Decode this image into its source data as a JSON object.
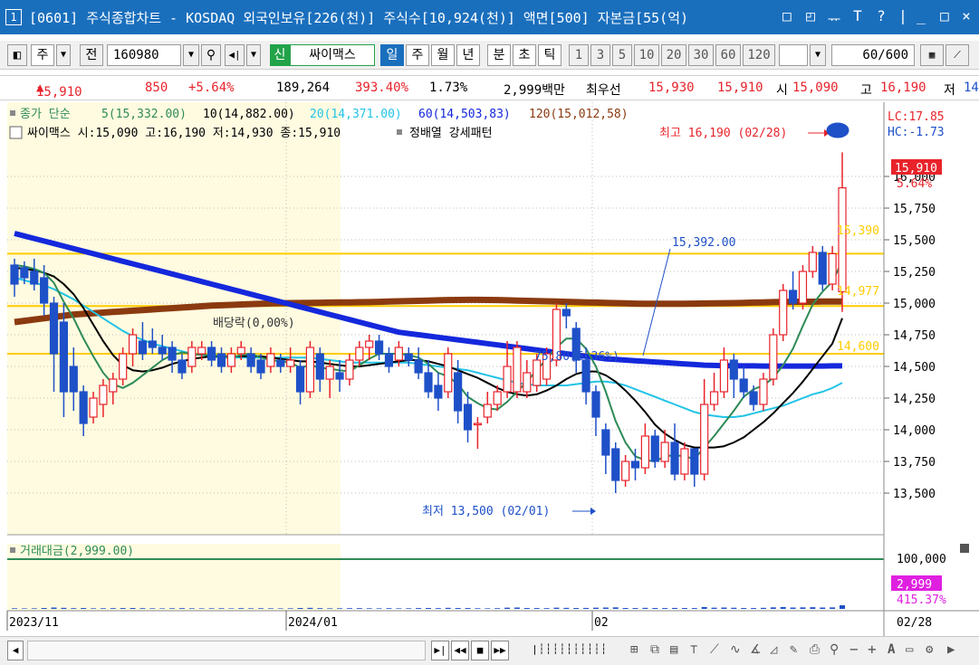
{
  "window": {
    "index": "1",
    "title": "[0601] 주식종합차트 - KOSDAQ 외국인보유[226(천)] 주식수[10,924(천)] 액면[500] 자본금[55(억)",
    "controls": [
      "□",
      "◰",
      "ᅲ",
      "T",
      "?",
      "|",
      "_",
      "□",
      "×"
    ]
  },
  "toolbar": {
    "type_label": "주",
    "prev_label": "전",
    "code": "160980",
    "new_badge": "신",
    "stock_name": "싸이맥스",
    "periods": [
      "일",
      "주",
      "월",
      "년",
      "분",
      "초",
      "틱"
    ],
    "selected_period": "일",
    "intervals": [
      "1",
      "3",
      "5",
      "10",
      "20",
      "30",
      "60",
      "120"
    ],
    "count": "60",
    "count_total": "/600"
  },
  "quote": {
    "price": "15,910",
    "change": "850",
    "change_pct": "+5.64%",
    "volume": "189,264",
    "volume_ratio": "393.40%",
    "turnover": "1.73%",
    "amount": "2,999백만",
    "best_label": "최우선",
    "ask": "15,930",
    "bid": "15,910",
    "open_label": "시",
    "open": "15,090",
    "high_label": "고",
    "high": "16,190",
    "low_label": "저",
    "low": "14"
  },
  "colors": {
    "up": "#e8232b",
    "down": "#1e50c8",
    "ma5": "#2e8b57",
    "ma10": "#000000",
    "ma20": "#22c3e6",
    "ma60": "#1428dc",
    "ma120": "#8b3a0f",
    "hline": "#ffcc00",
    "accent": "#1a6fbd"
  },
  "legend": {
    "close_label": "종가 단순",
    "ma5": "5(15,332.00)",
    "ma10": "10(14,882.00)",
    "ma20": "20(14,371.00)",
    "ma60": "60(14,503,83)",
    "ma120": "120(15,012,58)",
    "stock_line": "싸이맥스 시:15,090 고:16,190 저:14,930 종:15,910",
    "pattern": "정배열 강세패턴",
    "volume_label": "거래대금(2,999.00)"
  },
  "annotations": {
    "high": "최고 16,190 (02/28)",
    "low": "최저 13,500 (02/01)",
    "dividend": "배당락(0,00%)",
    "mid_value": "15,392.00",
    "pct_line": "75,80(5,36%)",
    "lc": "LC:17.85",
    "hc": "HC:-1.73",
    "price_box": "15,910",
    "price_pct": "5.64%",
    "vol_box": "2,999",
    "vol_pct": "415.37%",
    "hline_labels": [
      "15,390",
      "14,977",
      "14,600"
    ]
  },
  "axis": {
    "price_ticks": [
      "16,000",
      "15,750",
      "15,500",
      "15,250",
      "15,000",
      "14,750",
      "14,500",
      "14,250",
      "14,000",
      "13,750",
      "13,500"
    ],
    "volume_tick": "100,000",
    "date_ticks": [
      "2023/11",
      "2024/01",
      "02"
    ],
    "current_date": "02/28"
  },
  "chart_data": {
    "type": "candlestick",
    "ylim": [
      13300,
      16300
    ],
    "hlines": [
      15390,
      14977,
      14600
    ],
    "candles": [
      {
        "o": 15300,
        "h": 15350,
        "l": 15050,
        "c": 15150
      },
      {
        "o": 15280,
        "h": 15330,
        "l": 15150,
        "c": 15200
      },
      {
        "o": 15250,
        "h": 15350,
        "l": 15100,
        "c": 15150
      },
      {
        "o": 15200,
        "h": 15300,
        "l": 14900,
        "c": 15000
      },
      {
        "o": 15000,
        "h": 15050,
        "l": 14300,
        "c": 14600
      },
      {
        "o": 14850,
        "h": 15000,
        "l": 14100,
        "c": 14300
      },
      {
        "o": 14500,
        "h": 14650,
        "l": 14150,
        "c": 14300
      },
      {
        "o": 14300,
        "h": 14350,
        "l": 13950,
        "c": 14050
      },
      {
        "o": 14100,
        "h": 14300,
        "l": 14050,
        "c": 14250
      },
      {
        "o": 14200,
        "h": 14400,
        "l": 14100,
        "c": 14350
      },
      {
        "o": 14300,
        "h": 14450,
        "l": 14200,
        "c": 14400
      },
      {
        "o": 14400,
        "h": 14650,
        "l": 14350,
        "c": 14600
      },
      {
        "o": 14600,
        "h": 14800,
        "l": 14500,
        "c": 14750
      },
      {
        "o": 14700,
        "h": 14850,
        "l": 14550,
        "c": 14600
      },
      {
        "o": 14700,
        "h": 14800,
        "l": 14600,
        "c": 14650
      },
      {
        "o": 14650,
        "h": 14750,
        "l": 14550,
        "c": 14600
      },
      {
        "o": 14650,
        "h": 14700,
        "l": 14450,
        "c": 14550
      },
      {
        "o": 14550,
        "h": 14600,
        "l": 14400,
        "c": 14450
      },
      {
        "o": 14500,
        "h": 14700,
        "l": 14450,
        "c": 14650
      },
      {
        "o": 14600,
        "h": 14700,
        "l": 14550,
        "c": 14650
      },
      {
        "o": 14650,
        "h": 14700,
        "l": 14500,
        "c": 14550
      },
      {
        "o": 14600,
        "h": 14650,
        "l": 14450,
        "c": 14500
      },
      {
        "o": 14500,
        "h": 14650,
        "l": 14450,
        "c": 14600
      },
      {
        "o": 14600,
        "h": 14700,
        "l": 14550,
        "c": 14650
      },
      {
        "o": 14600,
        "h": 14650,
        "l": 14450,
        "c": 14500
      },
      {
        "o": 14550,
        "h": 14600,
        "l": 14400,
        "c": 14450
      },
      {
        "o": 14500,
        "h": 14650,
        "l": 14450,
        "c": 14600
      },
      {
        "o": 14550,
        "h": 14600,
        "l": 14450,
        "c": 14500
      },
      {
        "o": 14500,
        "h": 14650,
        "l": 14450,
        "c": 14550
      },
      {
        "o": 14500,
        "h": 14550,
        "l": 14200,
        "c": 14300
      },
      {
        "o": 14300,
        "h": 14700,
        "l": 14250,
        "c": 14650
      },
      {
        "o": 14600,
        "h": 14650,
        "l": 14300,
        "c": 14400
      },
      {
        "o": 14400,
        "h": 14550,
        "l": 14250,
        "c": 14500
      },
      {
        "o": 14450,
        "h": 14550,
        "l": 14300,
        "c": 14400
      },
      {
        "o": 14400,
        "h": 14600,
        "l": 14350,
        "c": 14550
      },
      {
        "o": 14550,
        "h": 14700,
        "l": 14500,
        "c": 14650
      },
      {
        "o": 14650,
        "h": 14750,
        "l": 14550,
        "c": 14700
      },
      {
        "o": 14700,
        "h": 14750,
        "l": 14550,
        "c": 14600
      },
      {
        "o": 14600,
        "h": 14650,
        "l": 14450,
        "c": 14500
      },
      {
        "o": 14550,
        "h": 14700,
        "l": 14500,
        "c": 14650
      },
      {
        "o": 14600,
        "h": 14650,
        "l": 14500,
        "c": 14550
      },
      {
        "o": 14550,
        "h": 14650,
        "l": 14400,
        "c": 14450
      },
      {
        "o": 14450,
        "h": 14550,
        "l": 14250,
        "c": 14300
      },
      {
        "o": 14350,
        "h": 14450,
        "l": 14150,
        "c": 14250
      },
      {
        "o": 14300,
        "h": 14650,
        "l": 14250,
        "c": 14600
      },
      {
        "o": 14450,
        "h": 14550,
        "l": 14050,
        "c": 14150
      },
      {
        "o": 14200,
        "h": 14300,
        "l": 13900,
        "c": 14000
      },
      {
        "o": 14050,
        "h": 14100,
        "l": 13850,
        "c": 14050
      },
      {
        "o": 14100,
        "h": 14300,
        "l": 14050,
        "c": 14200
      },
      {
        "o": 14200,
        "h": 14350,
        "l": 14150,
        "c": 14300
      },
      {
        "o": 14300,
        "h": 14700,
        "l": 14250,
        "c": 14500
      },
      {
        "o": 14300,
        "h": 14700,
        "l": 14250,
        "c": 14650
      },
      {
        "o": 14300,
        "h": 14550,
        "l": 14250,
        "c": 14450
      },
      {
        "o": 14350,
        "h": 14600,
        "l": 14300,
        "c": 14550
      },
      {
        "o": 14400,
        "h": 14650,
        "l": 14350,
        "c": 14600
      },
      {
        "o": 14550,
        "h": 15000,
        "l": 14500,
        "c": 14950
      },
      {
        "o": 14950,
        "h": 15000,
        "l": 14800,
        "c": 14900
      },
      {
        "o": 14800,
        "h": 14850,
        "l": 14450,
        "c": 14550
      },
      {
        "o": 14550,
        "h": 14650,
        "l": 14200,
        "c": 14300
      },
      {
        "o": 14300,
        "h": 14350,
        "l": 13950,
        "c": 14100
      },
      {
        "o": 14000,
        "h": 14050,
        "l": 13650,
        "c": 13800
      },
      {
        "o": 13850,
        "h": 13900,
        "l": 13500,
        "c": 13600
      },
      {
        "o": 13600,
        "h": 13800,
        "l": 13550,
        "c": 13750
      },
      {
        "o": 13750,
        "h": 13850,
        "l": 13600,
        "c": 13700
      },
      {
        "o": 13700,
        "h": 14050,
        "l": 13650,
        "c": 13950
      },
      {
        "o": 13950,
        "h": 14000,
        "l": 13700,
        "c": 13750
      },
      {
        "o": 13750,
        "h": 14000,
        "l": 13700,
        "c": 13900
      },
      {
        "o": 13900,
        "h": 14050,
        "l": 13600,
        "c": 13650
      },
      {
        "o": 13650,
        "h": 13900,
        "l": 13600,
        "c": 13850
      },
      {
        "o": 13850,
        "h": 13850,
        "l": 13550,
        "c": 13650
      },
      {
        "o": 13650,
        "h": 14400,
        "l": 13600,
        "c": 14200
      },
      {
        "o": 14200,
        "h": 14450,
        "l": 14150,
        "c": 14300
      },
      {
        "o": 14300,
        "h": 14650,
        "l": 14250,
        "c": 14550
      },
      {
        "o": 14550,
        "h": 14600,
        "l": 14250,
        "c": 14400
      },
      {
        "o": 14400,
        "h": 14500,
        "l": 14250,
        "c": 14300
      },
      {
        "o": 14300,
        "h": 14350,
        "l": 14150,
        "c": 14200
      },
      {
        "o": 14200,
        "h": 14450,
        "l": 14150,
        "c": 14400
      },
      {
        "o": 14400,
        "h": 14800,
        "l": 14350,
        "c": 14750
      },
      {
        "o": 14750,
        "h": 15150,
        "l": 14700,
        "c": 15100
      },
      {
        "o": 15100,
        "h": 15250,
        "l": 14950,
        "c": 15000
      },
      {
        "o": 15000,
        "h": 15300,
        "l": 14950,
        "c": 15250
      },
      {
        "o": 15250,
        "h": 15450,
        "l": 15200,
        "c": 15400
      },
      {
        "o": 15400,
        "h": 15450,
        "l": 15100,
        "c": 15150
      },
      {
        "o": 15150,
        "h": 15450,
        "l": 15100,
        "c": 15390
      },
      {
        "o": 15090,
        "h": 16190,
        "l": 14930,
        "c": 15910
      }
    ],
    "ma5": [
      15300,
      15290,
      15270,
      15240,
      15160,
      15010,
      14880,
      14720,
      14580,
      14450,
      14360,
      14330,
      14370,
      14430,
      14490,
      14550,
      14590,
      14610,
      14600,
      14590,
      14590,
      14580,
      14570,
      14590,
      14600,
      14570,
      14550,
      14540,
      14530,
      14490,
      14510,
      14490,
      14480,
      14470,
      14460,
      14510,
      14560,
      14600,
      14600,
      14600,
      14590,
      14570,
      14520,
      14450,
      14420,
      14360,
      14260,
      14210,
      14170,
      14160,
      14220,
      14300,
      14380,
      14470,
      14560,
      14650,
      14720,
      14720,
      14640,
      14500,
      14300,
      14070,
      13900,
      13790,
      13760,
      13750,
      13790,
      13800,
      13790,
      13770,
      13860,
      13950,
      14050,
      14150,
      14260,
      14320,
      14350,
      14410,
      14510,
      14640,
      14820,
      14990,
      15090,
      15170,
      15330
    ],
    "ma10": [
      15280,
      15270,
      15260,
      15240,
      15210,
      15150,
      15070,
      14960,
      14830,
      14700,
      14590,
      14510,
      14470,
      14460,
      14470,
      14490,
      14520,
      14540,
      14560,
      14570,
      14580,
      14580,
      14580,
      14580,
      14580,
      14580,
      14570,
      14560,
      14550,
      14540,
      14540,
      14530,
      14520,
      14510,
      14500,
      14500,
      14510,
      14520,
      14530,
      14540,
      14550,
      14550,
      14540,
      14520,
      14500,
      14470,
      14440,
      14410,
      14370,
      14330,
      14300,
      14280,
      14270,
      14280,
      14310,
      14350,
      14400,
      14440,
      14460,
      14460,
      14430,
      14380,
      14310,
      14230,
      14140,
      14040,
      13970,
      13920,
      13880,
      13860,
      13860,
      13860,
      13870,
      13900,
      13940,
      14000,
      14060,
      14130,
      14210,
      14290,
      14380,
      14480,
      14580,
      14680,
      14880
    ],
    "ma20": [
      15200,
      15180,
      15160,
      15140,
      15110,
      15070,
      15030,
      14980,
      14930,
      14880,
      14830,
      14780,
      14740,
      14710,
      14680,
      14660,
      14640,
      14620,
      14600,
      14590,
      14580,
      14570,
      14570,
      14570,
      14570,
      14570,
      14570,
      14570,
      14570,
      14570,
      14570,
      14560,
      14550,
      14540,
      14530,
      14530,
      14530,
      14530,
      14530,
      14530,
      14530,
      14520,
      14510,
      14500,
      14490,
      14480,
      14470,
      14450,
      14430,
      14410,
      14390,
      14370,
      14360,
      14350,
      14350,
      14350,
      14350,
      14360,
      14370,
      14380,
      14380,
      14370,
      14350,
      14320,
      14290,
      14260,
      14230,
      14200,
      14170,
      14140,
      14120,
      14110,
      14100,
      14100,
      14110,
      14130,
      14150,
      14170,
      14190,
      14220,
      14250,
      14280,
      14300,
      14330,
      14371
    ],
    "ma60": [
      15550,
      15530,
      15510,
      15490,
      15470,
      15450,
      15430,
      15410,
      15390,
      15370,
      15350,
      15330,
      15310,
      15290,
      15270,
      15250,
      15230,
      15210,
      15190,
      15170,
      15150,
      15130,
      15110,
      15090,
      15070,
      15050,
      15030,
      15010,
      14990,
      14970,
      14950,
      14930,
      14910,
      14890,
      14870,
      14850,
      14830,
      14810,
      14790,
      14770,
      14760,
      14750,
      14740,
      14730,
      14720,
      14710,
      14700,
      14690,
      14680,
      14670,
      14660,
      14650,
      14640,
      14630,
      14620,
      14610,
      14600,
      14590,
      14580,
      14570,
      14560,
      14555,
      14550,
      14545,
      14540,
      14535,
      14530,
      14525,
      14520,
      14515,
      14510,
      14508,
      14506,
      14505,
      14504,
      14504,
      14503,
      14503,
      14503,
      14503,
      14503,
      14503,
      14503,
      14504,
      14504
    ],
    "ma120": [
      14850,
      14860,
      14870,
      14880,
      14890,
      14900,
      14910,
      14915,
      14920,
      14925,
      14930,
      14935,
      14940,
      14945,
      14950,
      14955,
      14960,
      14965,
      14970,
      14975,
      14980,
      14983,
      14986,
      14989,
      14992,
      14995,
      14997,
      14999,
      15000,
      15001,
      15002,
      15003,
      15004,
      15005,
      15006,
      15007,
      15008,
      15010,
      15012,
      15014,
      15016,
      15018,
      15020,
      15022,
      15024,
      15025,
      15026,
      15026,
      15025,
      15024,
      15022,
      15020,
      15018,
      15016,
      15014,
      15012,
      15010,
      15008,
      15006,
      15004,
      15002,
      15000,
      14998,
      14996,
      14995,
      14994,
      14994,
      14994,
      14995,
      14996,
      14997,
      14998,
      14999,
      15000,
      15002,
      15004,
      15006,
      15008,
      15009,
      15010,
      15011,
      15011,
      15012,
      15012,
      15013
    ],
    "volume": [
      22,
      18,
      20,
      30,
      45,
      35,
      25,
      30,
      20,
      22,
      25,
      28,
      30,
      24,
      20,
      18,
      22,
      25,
      20,
      18,
      20,
      22,
      18,
      24,
      20,
      22,
      20,
      18,
      20,
      30,
      35,
      25,
      20,
      22,
      24,
      26,
      22,
      20,
      24,
      20,
      22,
      28,
      30,
      26,
      35,
      30,
      28,
      22,
      20,
      24,
      40,
      45,
      30,
      28,
      26,
      40,
      35,
      30,
      32,
      40,
      45,
      50,
      30,
      28,
      35,
      30,
      28,
      32,
      30,
      28,
      60,
      40,
      45,
      38,
      30,
      28,
      35,
      50,
      60,
      45,
      50,
      55,
      45,
      50,
      120
    ]
  }
}
